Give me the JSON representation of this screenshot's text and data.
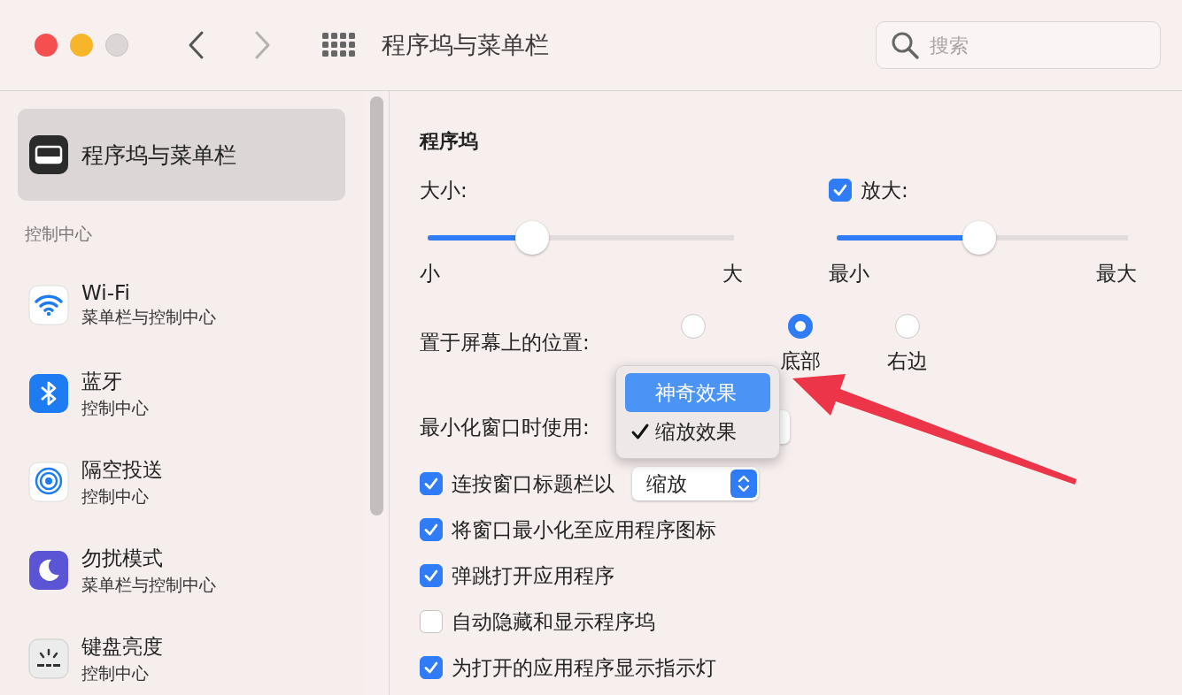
{
  "window": {
    "title": "程序坞与菜单栏"
  },
  "search": {
    "placeholder": "搜索"
  },
  "sidebar": {
    "top_item": {
      "title": "程序坞与菜单栏",
      "selected": true
    },
    "section": "控制中心",
    "items": [
      {
        "title": "Wi-Fi",
        "subtitle": "菜单栏与控制中心",
        "selected": false
      },
      {
        "title": "蓝牙",
        "subtitle": "控制中心",
        "selected": false
      },
      {
        "title": "隔空投送",
        "subtitle": "控制中心",
        "selected": false
      },
      {
        "title": "勿扰模式",
        "subtitle": "菜单栏与控制中心",
        "selected": false
      },
      {
        "title": "键盘亮度",
        "subtitle": "控制中心",
        "selected": false
      }
    ]
  },
  "dock": {
    "heading": "程序坞",
    "size": {
      "label": "大小:",
      "level": 0.34,
      "min_label": "小",
      "max_label": "大"
    },
    "magnification": {
      "label": "放大:",
      "checked": true,
      "level": 0.49,
      "min_label": "最小",
      "max_label": "最大"
    },
    "position": {
      "label": "置于屏幕上的位置:",
      "options": [
        {
          "selected": false
        },
        {
          "label": "底部",
          "selected": true
        },
        {
          "label": "右边",
          "selected": false
        }
      ]
    },
    "minimize": {
      "label": "最小化窗口时使用:"
    },
    "options": [
      {
        "label": "连按窗口标题栏以",
        "checked": true,
        "dropdown": "缩放"
      },
      {
        "label": "将窗口最小化至应用程序图标",
        "checked": true
      },
      {
        "label": "弹跳打开应用程序",
        "checked": true
      },
      {
        "label": "自动隐藏和显示程序坞",
        "checked": false
      },
      {
        "label": "为打开的应用程序显示指示灯",
        "checked": true
      }
    ]
  },
  "menu": {
    "items": [
      {
        "label": "神奇效果",
        "highlighted": true,
        "checked": false
      },
      {
        "label": "缩放效果",
        "highlighted": false,
        "checked": true
      }
    ]
  }
}
